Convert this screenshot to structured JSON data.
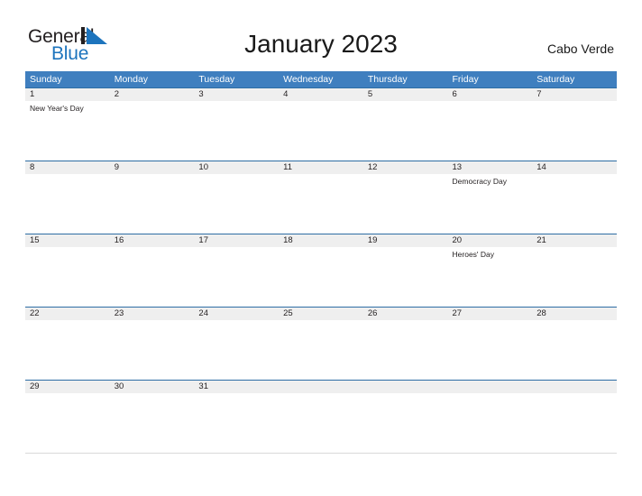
{
  "brand": {
    "name_part1": "General",
    "name_part2": "Blue",
    "flag_icon": "blue-triangle-flag-icon",
    "flag_color": "#1d74bd",
    "text_color": "#231f20"
  },
  "header": {
    "title": "January 2023",
    "country": "Cabo Verde"
  },
  "colors": {
    "header_blue": "#3f7fbf",
    "row_divider_blue": "#2e6da4",
    "date_band_gray": "#efefef",
    "text_dark": "#231f20",
    "white": "#ffffff"
  },
  "calendar": {
    "month": "January",
    "year": "2023",
    "weekday_headers": [
      "Sunday",
      "Monday",
      "Tuesday",
      "Wednesday",
      "Thursday",
      "Friday",
      "Saturday"
    ],
    "weeks": [
      [
        {
          "date": "1",
          "event": "New Year's Day"
        },
        {
          "date": "2",
          "event": ""
        },
        {
          "date": "3",
          "event": ""
        },
        {
          "date": "4",
          "event": ""
        },
        {
          "date": "5",
          "event": ""
        },
        {
          "date": "6",
          "event": ""
        },
        {
          "date": "7",
          "event": ""
        }
      ],
      [
        {
          "date": "8",
          "event": ""
        },
        {
          "date": "9",
          "event": ""
        },
        {
          "date": "10",
          "event": ""
        },
        {
          "date": "11",
          "event": ""
        },
        {
          "date": "12",
          "event": ""
        },
        {
          "date": "13",
          "event": "Democracy Day"
        },
        {
          "date": "14",
          "event": ""
        }
      ],
      [
        {
          "date": "15",
          "event": ""
        },
        {
          "date": "16",
          "event": ""
        },
        {
          "date": "17",
          "event": ""
        },
        {
          "date": "18",
          "event": ""
        },
        {
          "date": "19",
          "event": ""
        },
        {
          "date": "20",
          "event": "Heroes' Day"
        },
        {
          "date": "21",
          "event": ""
        }
      ],
      [
        {
          "date": "22",
          "event": ""
        },
        {
          "date": "23",
          "event": ""
        },
        {
          "date": "24",
          "event": ""
        },
        {
          "date": "25",
          "event": ""
        },
        {
          "date": "26",
          "event": ""
        },
        {
          "date": "27",
          "event": ""
        },
        {
          "date": "28",
          "event": ""
        }
      ],
      [
        {
          "date": "29",
          "event": ""
        },
        {
          "date": "30",
          "event": ""
        },
        {
          "date": "31",
          "event": ""
        },
        {
          "date": "",
          "event": ""
        },
        {
          "date": "",
          "event": ""
        },
        {
          "date": "",
          "event": ""
        },
        {
          "date": "",
          "event": ""
        }
      ]
    ]
  }
}
